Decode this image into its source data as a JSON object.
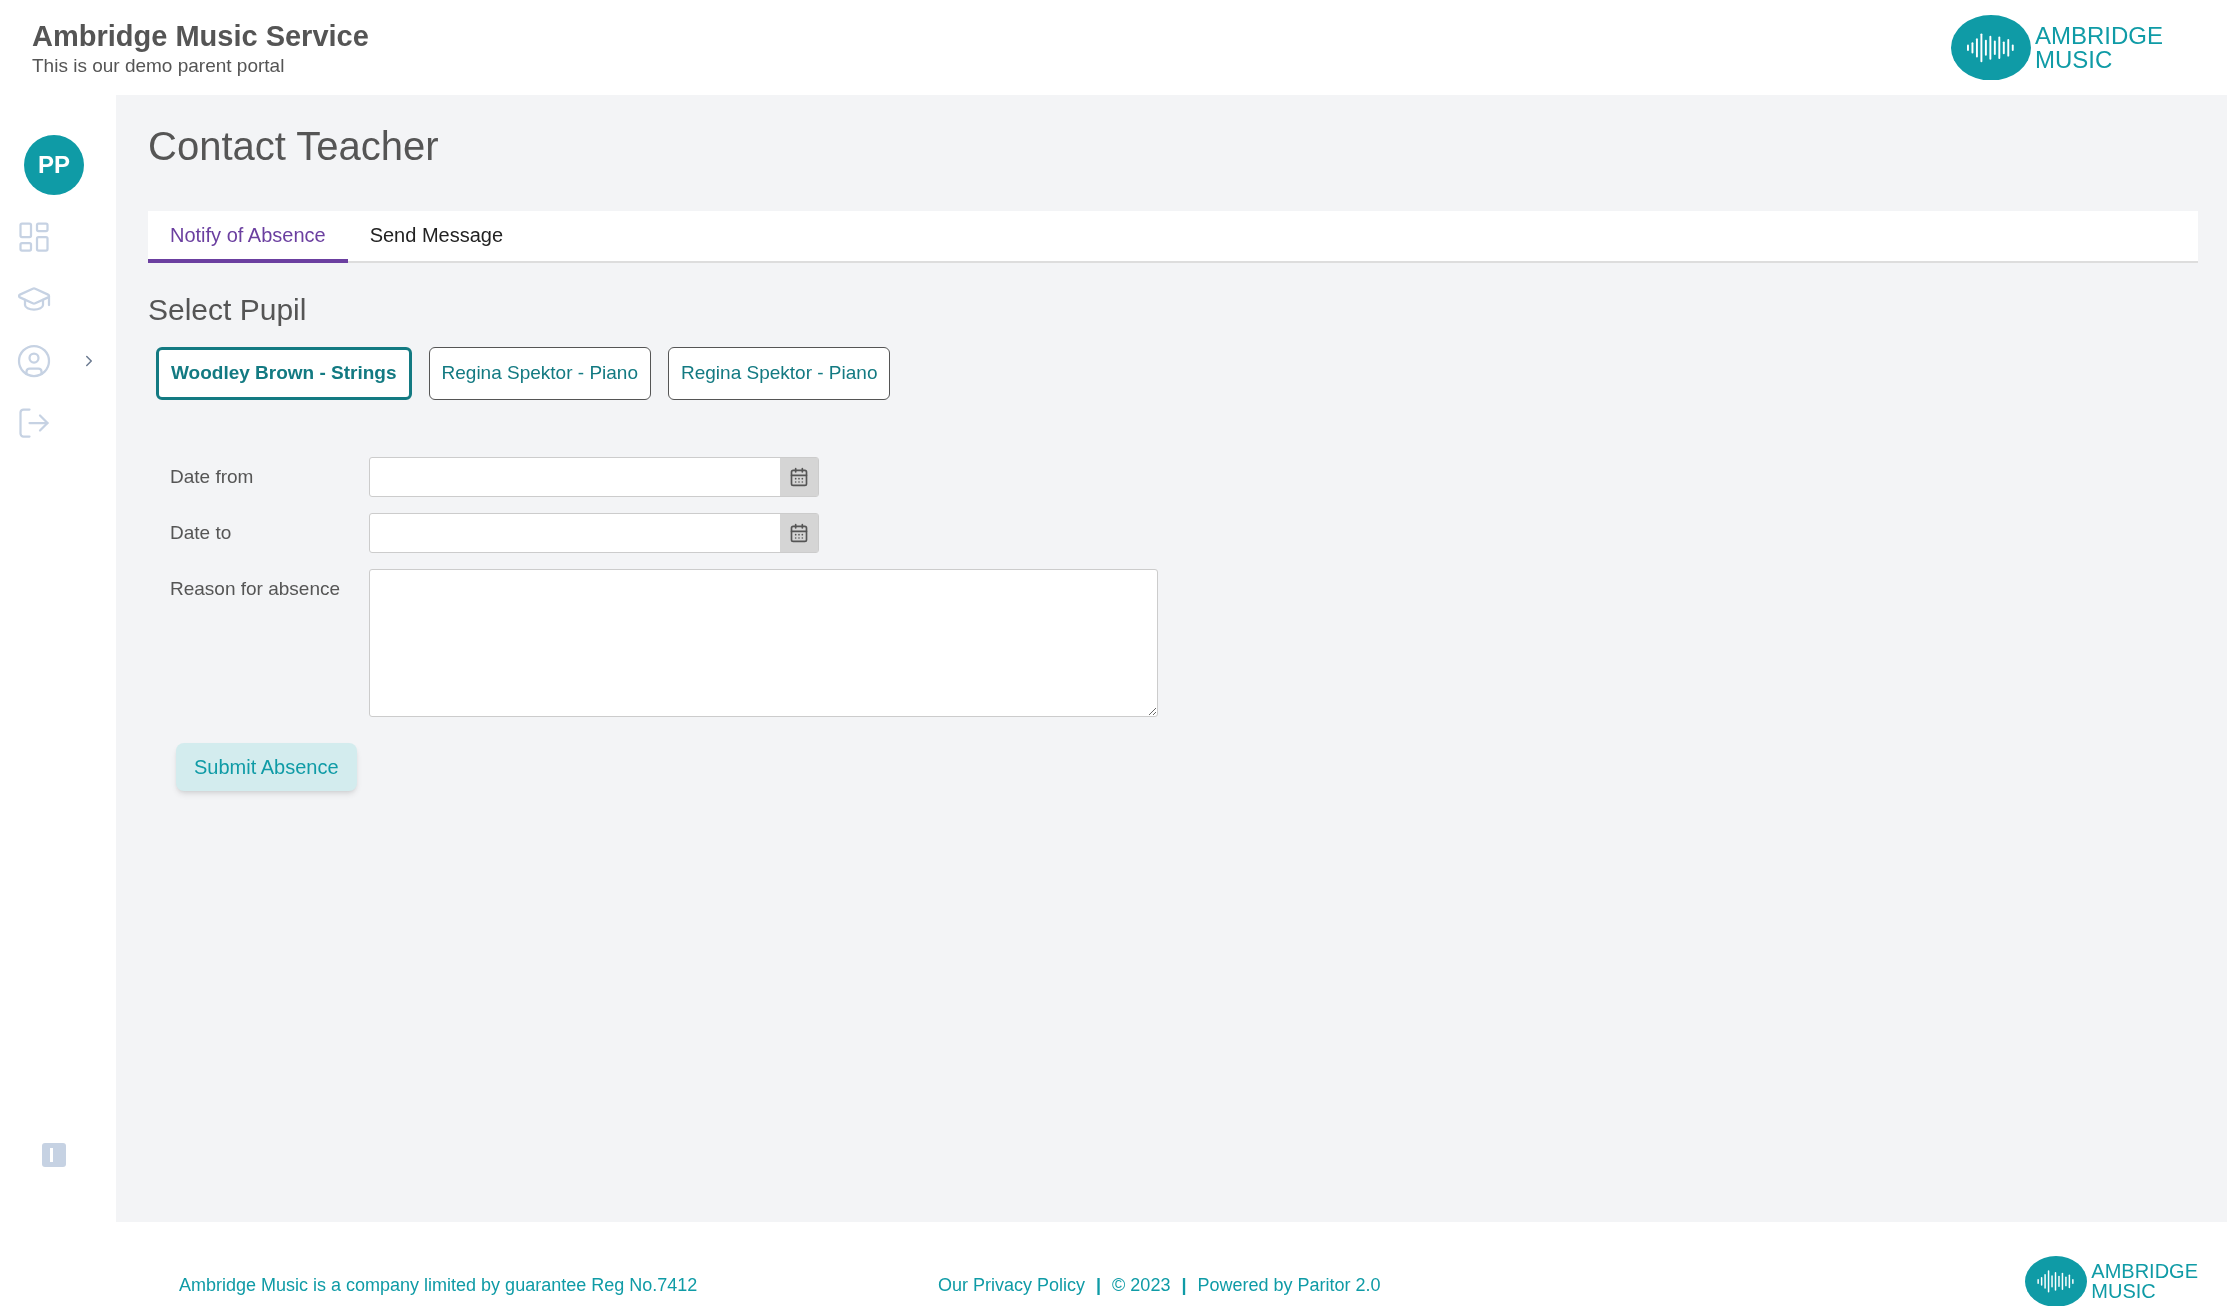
{
  "header": {
    "title": "Ambridge Music Service",
    "subtitle": "This is our demo parent portal",
    "logo": {
      "line1": "AMBRIDGE",
      "line2": "MUSIC"
    }
  },
  "sidebar": {
    "avatar": "PP",
    "items": [
      {
        "kind": "dashboard",
        "expandable": false
      },
      {
        "kind": "courses",
        "expandable": false
      },
      {
        "kind": "profile",
        "expandable": true
      },
      {
        "kind": "logout",
        "expandable": false
      }
    ]
  },
  "page": {
    "title": "Contact Teacher"
  },
  "tabs": [
    {
      "label": "Notify of Absence",
      "selected": true
    },
    {
      "label": "Send Message",
      "selected": false
    }
  ],
  "pupil_section": {
    "title": "Select Pupil",
    "pupils": [
      {
        "label": "Woodley Brown - Strings",
        "selected": true
      },
      {
        "label": "Regina Spektor - Piano",
        "selected": false
      },
      {
        "label": "Regina Spektor - Piano",
        "selected": false
      }
    ]
  },
  "form": {
    "fields": [
      {
        "label": "Date from",
        "kind": "date"
      },
      {
        "label": "Date to",
        "kind": "date"
      },
      {
        "label": "Reason for absence",
        "kind": "textarea"
      }
    ],
    "submit": "Submit Absence"
  },
  "footer": {
    "company": "Ambridge Music is a company limited by guarantee Reg No.7412",
    "links": [
      {
        "text": "Our Privacy Policy",
        "kind": "link"
      },
      {
        "text": "|",
        "kind": "separator"
      },
      {
        "text": "© 2023",
        "kind": "text"
      },
      {
        "text": "|",
        "kind": "separator"
      },
      {
        "text": "Powered by Paritor 2.0",
        "kind": "text"
      }
    ],
    "logo": {
      "line1": "AMBRIDGE",
      "line2": "MUSIC"
    }
  }
}
